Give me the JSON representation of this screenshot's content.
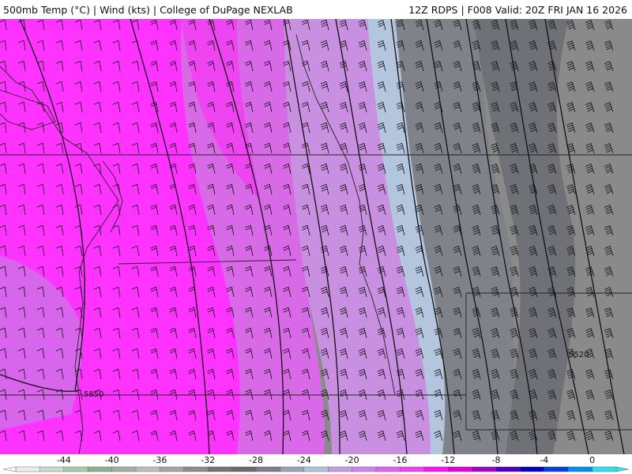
{
  "header": {
    "left": "500mb Temp (°C) | Wind (kts) | College of DuPage NEXLAB",
    "right": "12Z RDPS | F008 Valid: 20Z FRI JAN 16 2026"
  },
  "colorbar": {
    "ticks": [
      "-44",
      "-40",
      "-36",
      "-32",
      "-28",
      "-24",
      "-20",
      "-16",
      "-12",
      "-8",
      "-4",
      "0"
    ],
    "tick_values": [
      -44,
      -40,
      -36,
      -32,
      -28,
      -24,
      -20,
      -16,
      -12,
      -8,
      -4,
      0
    ],
    "range": [
      -48,
      2
    ],
    "colors": [
      "#e8f0e8",
      "#c7dcc7",
      "#a9c8a9",
      "#8fb08f",
      "#a2b0a2",
      "#bcbcbc",
      "#a4a4a4",
      "#8c8c8c",
      "#747474",
      "#6a6a70",
      "#7c7e90",
      "#9aa2b4",
      "#b0c4d6",
      "#c0a0e0",
      "#d080f0",
      "#e060f8",
      "#f040f8",
      "#ff10ff",
      "#e000e0",
      "#a000d0",
      "#5000c0",
      "#0000c0",
      "#0040e0",
      "#0090f0",
      "#30e0f0"
    ]
  },
  "map": {
    "temperature_colors": {
      "minus_30_and_colder": "#ff33ff",
      "minus_28": "#ee44f2",
      "minus_24": "#d86ae8",
      "minus_20": "#c98fe0",
      "minus_16": "#b4c6de",
      "minus_12": "#9fa8b5",
      "minus_10": "#868b93",
      "minus_8": "#6f7176",
      "minus_6": "#8a8a8a"
    },
    "contour_labels": [
      {
        "text": "5850"
      },
      {
        "text": "5520"
      }
    ]
  }
}
